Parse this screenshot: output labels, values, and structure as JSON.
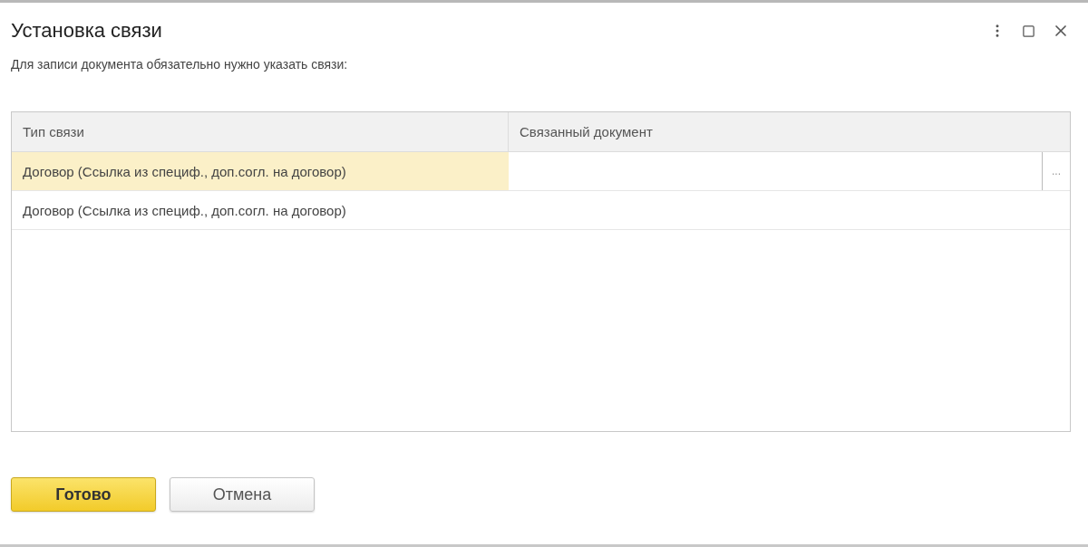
{
  "window": {
    "title": "Установка связи"
  },
  "message": "Для записи документа обязательно нужно указать связи:",
  "table": {
    "columns": [
      "Тип связи",
      "Связанный документ"
    ],
    "rows": [
      {
        "link_type": "Договор (Ссылка из специф., доп.согл. на договор)",
        "selected": true,
        "choice_button": "..."
      },
      {
        "link_type": "Договор (Ссылка из специф., доп.согл. на договор)",
        "selected": false
      }
    ]
  },
  "buttons": [
    {
      "label": "Готово",
      "kind": "default"
    },
    {
      "label": "Отмена",
      "kind": "normal"
    }
  ]
}
